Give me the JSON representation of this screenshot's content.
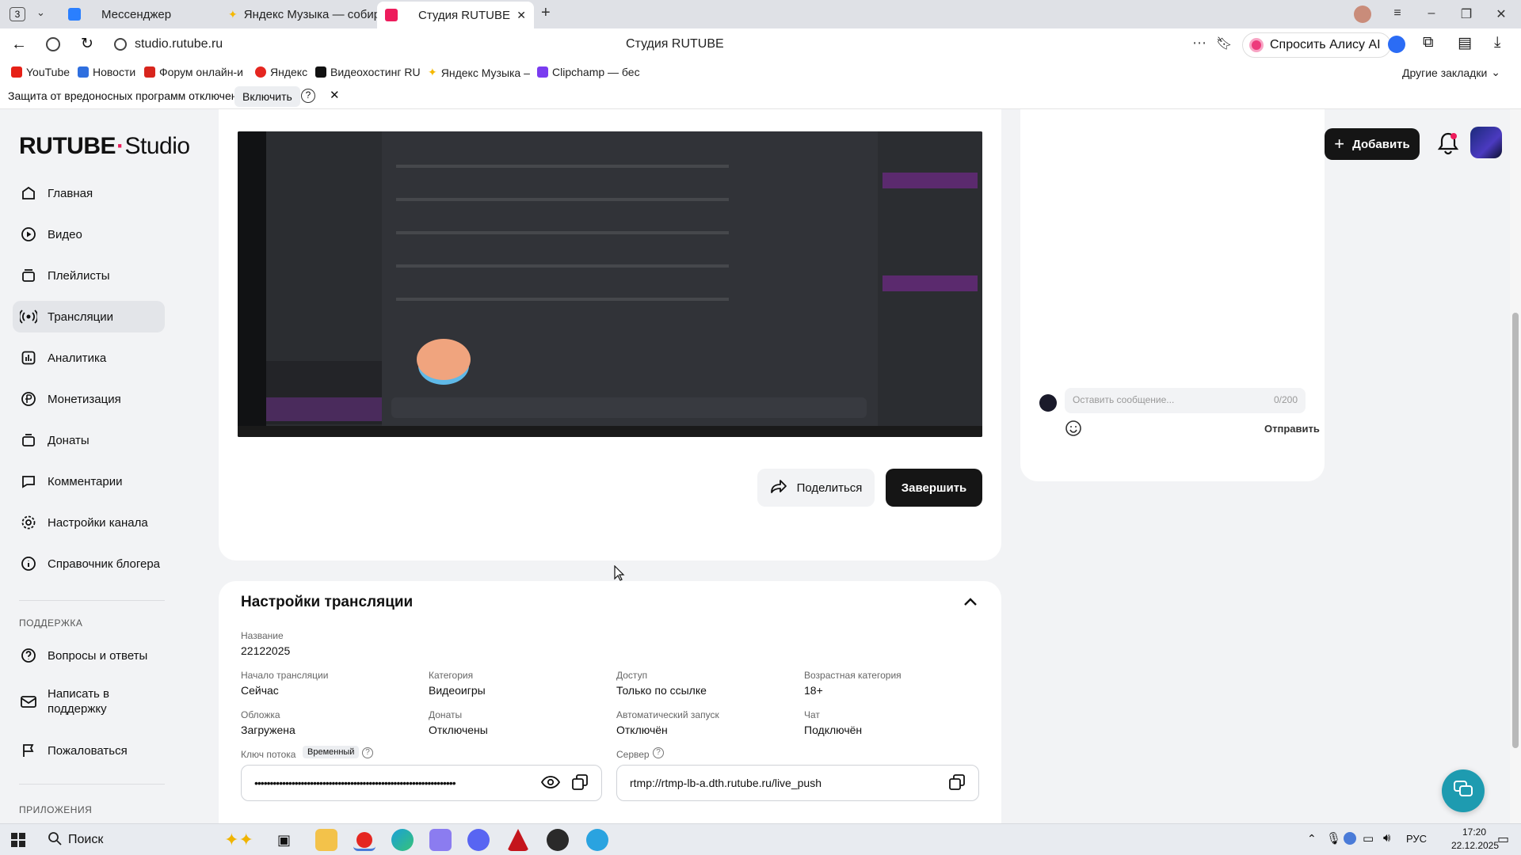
{
  "browser": {
    "tab_count": "3",
    "tabs": [
      {
        "label": "Мессенджер"
      },
      {
        "label": "Яндекс Музыка — собир"
      },
      {
        "label": "Студия RUTUBE"
      }
    ],
    "url": "studio.rutube.ru",
    "page_title": "Студия RUTUBE",
    "alice_label": "Спросить Алису AI",
    "bookmarks": [
      "YouTube",
      "Новости",
      "Форум онлайн-и",
      "Яндекс",
      "Видеохостинг RU",
      "Яндекс Музыка –",
      "Clipchamp — бес"
    ],
    "other_bookmarks": "Другие закладки",
    "infobar_text": "Защита от вредоносных программ отключена",
    "infobar_button": "Включить",
    "infobar_help": "?"
  },
  "header": {
    "logo_main": "RUTUBE",
    "logo_studio": "Studio",
    "add_button": "Добавить"
  },
  "sidebar": {
    "items": [
      {
        "label": "Главная",
        "icon": "home-icon"
      },
      {
        "label": "Видео",
        "icon": "video-icon"
      },
      {
        "label": "Плейлисты",
        "icon": "playlist-icon"
      },
      {
        "label": "Трансляции",
        "icon": "broadcast-icon"
      },
      {
        "label": "Аналитика",
        "icon": "analytics-icon"
      },
      {
        "label": "Монетизация",
        "icon": "monetization-icon"
      },
      {
        "label": "Донаты",
        "icon": "donate-icon"
      },
      {
        "label": "Комментарии",
        "icon": "comments-icon"
      },
      {
        "label": "Настройки канала",
        "icon": "gear-icon"
      },
      {
        "label": "Справочник блогера",
        "icon": "info-icon"
      }
    ],
    "support_title": "ПОДДЕРЖКА",
    "support_items": [
      {
        "label": "Вопросы и ответы",
        "icon": "faq-icon"
      },
      {
        "label": "Написать в поддержку",
        "icon": "mail-icon"
      },
      {
        "label": "Пожаловаться",
        "icon": "flag-icon"
      }
    ],
    "apps_title": "ПРИЛОЖЕНИЯ"
  },
  "stream": {
    "share_button": "Поделиться",
    "finish_button": "Завершить"
  },
  "chat": {
    "placeholder": "Оставить сообщение...",
    "counter": "0/200",
    "send_button": "Отправить"
  },
  "settings": {
    "title": "Настройки трансляции",
    "name_label": "Название",
    "name_value": "22122025",
    "fields": [
      {
        "label": "Начало трансляции",
        "value": "Сейчас"
      },
      {
        "label": "Категория",
        "value": "Видеоигры"
      },
      {
        "label": "Доступ",
        "value": "Только по ссылке"
      },
      {
        "label": "Возрастная категория",
        "value": "18+"
      },
      {
        "label": "Обложка",
        "value": "Загружена"
      },
      {
        "label": "Донаты",
        "value": "Отключены"
      },
      {
        "label": "Автоматический запуск",
        "value": "Отключён"
      },
      {
        "label": "Чат",
        "value": "Подключён"
      }
    ],
    "stream_key_label": "Ключ потока",
    "stream_key_badge": "Временный",
    "stream_key_value": "•••••••••••••••••••••••••••••••••••••••••••••••••••••••••••••••••",
    "server_label": "Сервер",
    "server_value": "rtmp://rtmp-lb-a.dth.rutube.ru/live_push"
  },
  "taskbar": {
    "search": "Поиск",
    "lang": "РУС",
    "time": "17:20",
    "date": "22.12.2025"
  },
  "colors": {
    "accent": "#ed1c5c",
    "dark_button": "#151515",
    "sidebar_active": "#e3e5e9",
    "page_bg": "#f2f3f5"
  }
}
